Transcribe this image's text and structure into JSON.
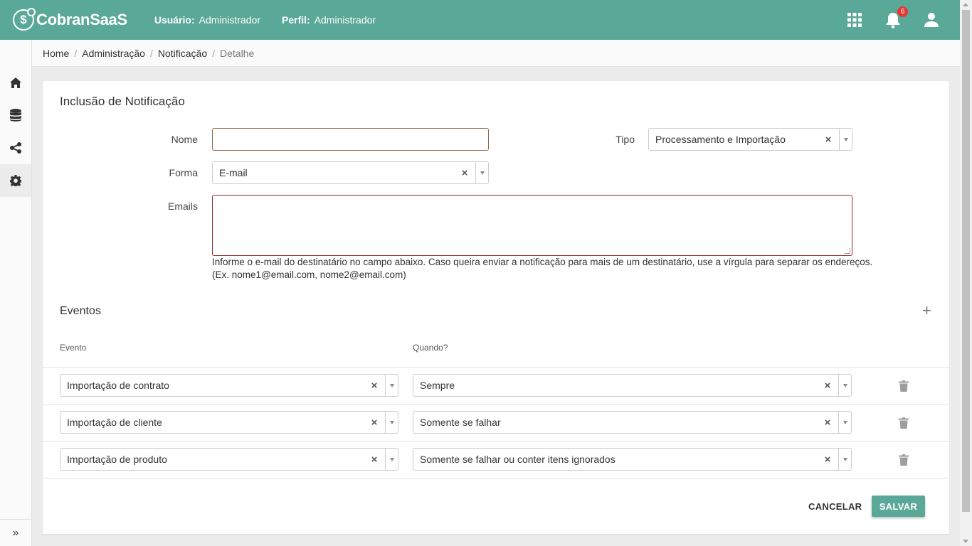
{
  "header": {
    "brand": "CobranSaaS",
    "user_label": "Usuário:",
    "user_value": "Administrador",
    "profile_label": "Perfil:",
    "profile_value": "Administrador",
    "notification_count": "6",
    "brand_color": "#5aa897",
    "icons": [
      "apps-grid-icon",
      "bell-icon",
      "user-icon"
    ]
  },
  "sidebar": {
    "items": [
      {
        "icon": "home-icon"
      },
      {
        "icon": "database-icon"
      },
      {
        "icon": "share-icon"
      },
      {
        "icon": "gear-icon",
        "active": true
      }
    ],
    "toggle": "»"
  },
  "breadcrumb": {
    "items": [
      "Home",
      "Administração",
      "Notificação"
    ],
    "current": "Detalhe"
  },
  "form": {
    "title": "Inclusão de Notificação",
    "nome_label": "Nome",
    "nome_value": "",
    "tipo_label": "Tipo",
    "tipo_value": "Processamento e Importação",
    "forma_label": "Forma",
    "forma_value": "E-mail",
    "emails_label": "Emails",
    "emails_value": "",
    "help_text": "Informe o e-mail do destinatário no campo abaixo. Caso queira enviar a notificação para mais de um destinatário, use a vírgula para separar os endereços. (Ex. nome1@email.com, nome2@email.com)"
  },
  "events": {
    "title": "Eventos",
    "col_event": "Evento",
    "col_when": "Quando?",
    "rows": [
      {
        "event": "Importação de contrato",
        "when": "Sempre"
      },
      {
        "event": "Importação de cliente",
        "when": "Somente se falhar"
      },
      {
        "event": "Importação de produto",
        "when": "Somente se falhar ou conter itens ignorados"
      }
    ]
  },
  "actions": {
    "cancel": "CANCELAR",
    "save": "SALVAR"
  }
}
